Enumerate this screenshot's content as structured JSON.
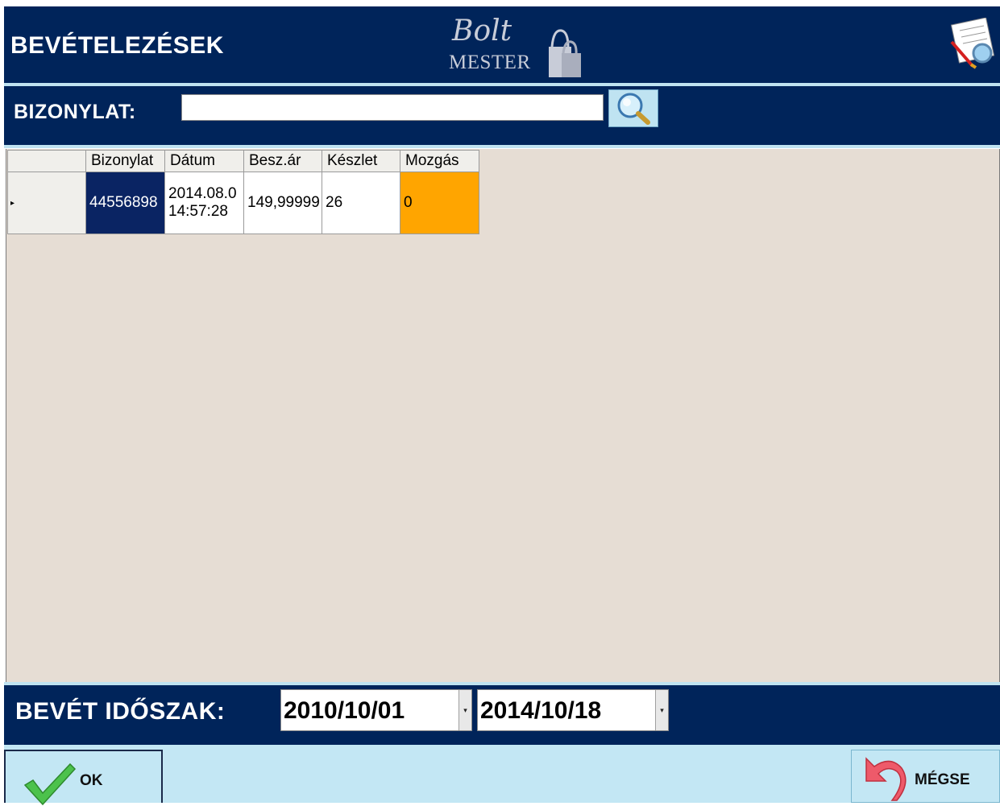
{
  "header": {
    "title": "BEVÉTELEZÉSEK",
    "logo_script": "Bolt",
    "logo_sub": "MESTER",
    "right_icon": "report-search-icon"
  },
  "search": {
    "label": "BIZONYLAT:",
    "value": "",
    "placeholder": "",
    "button_icon": "magnifier-icon"
  },
  "grid": {
    "columns": [
      "",
      "Bizonylat",
      "Dátum",
      "Besz.ár",
      "Készlet",
      "Mozgás"
    ],
    "rows": [
      {
        "indicator": "▸",
        "bizonylat": "44556898",
        "datum_line1": "2014.08.0",
        "datum_line2": "14:57:28",
        "besz_ar": "149,99999",
        "keszlet": "26",
        "mozgas": "0"
      }
    ]
  },
  "period": {
    "label": "BEVÉT IDŐSZAK:",
    "from": "2010/10/01",
    "to": "2014/10/18"
  },
  "footer": {
    "ok_label": "OK",
    "cancel_label": "MÉGSE"
  },
  "colors": {
    "navy": "#00245a",
    "light_blue": "#c3e7f4",
    "grid_bg": "#e6ddd4",
    "selected_cell": "#0a2463",
    "highlight": "#ffa500"
  }
}
